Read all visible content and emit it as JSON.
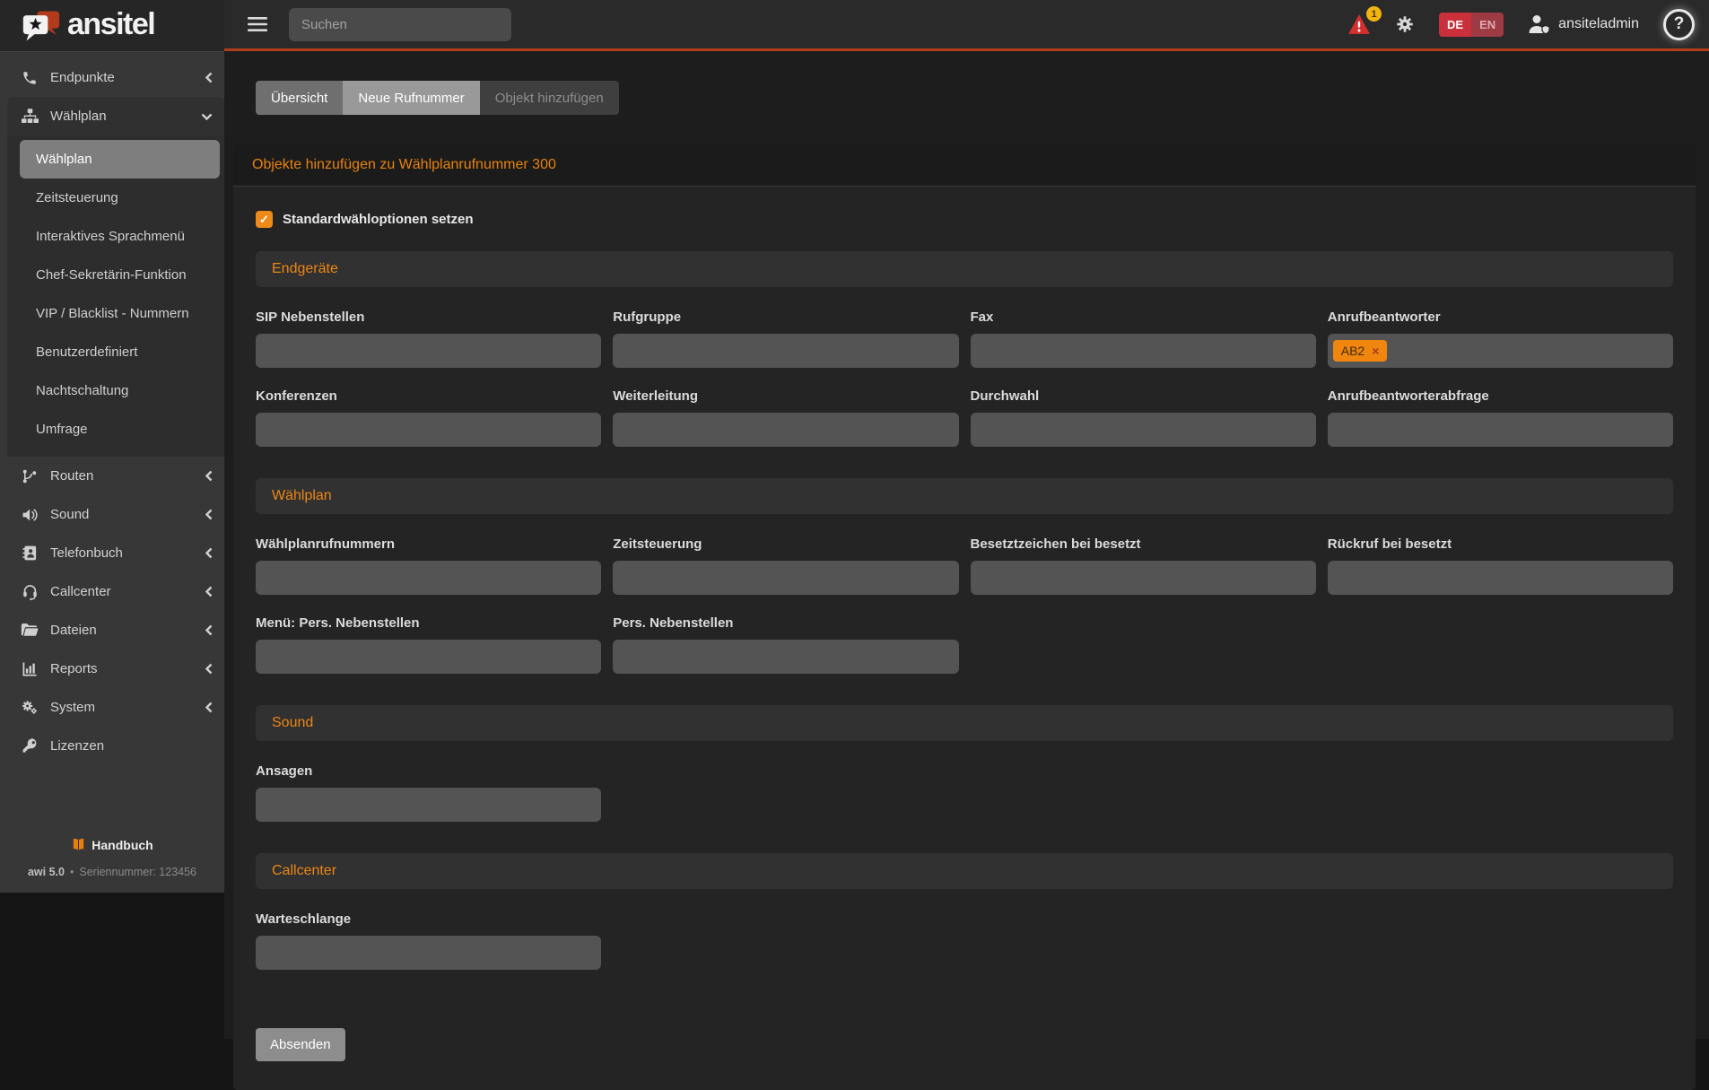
{
  "brand": {
    "name": "ansitel",
    "logo_icon": "speech-bubble-star-icon"
  },
  "topbar": {
    "search_placeholder": "Suchen",
    "alert_badge": "1",
    "languages": {
      "de": "DE",
      "en": "EN"
    },
    "username": "ansiteladmin",
    "help_glyph": "?"
  },
  "sidebar": {
    "items": [
      {
        "label": "Endpunkte",
        "icon": "phone-icon"
      },
      {
        "label": "Wählplan",
        "icon": "sitemap-icon",
        "expanded": true
      },
      {
        "label": "Routen",
        "icon": "route-branch-icon"
      },
      {
        "label": "Sound",
        "icon": "speaker-icon"
      },
      {
        "label": "Telefonbuch",
        "icon": "address-book-icon"
      },
      {
        "label": "Callcenter",
        "icon": "headset-icon"
      },
      {
        "label": "Dateien",
        "icon": "folder-open-icon"
      },
      {
        "label": "Reports",
        "icon": "bar-chart-icon"
      },
      {
        "label": "System",
        "icon": "gears-icon"
      },
      {
        "label": "Lizenzen",
        "icon": "key-icon"
      }
    ],
    "waehlplan_children": [
      "Wählplan",
      "Zeitsteuerung",
      "Interaktives Sprachmenü",
      "Chef-Sekretärin-Funktion",
      "VIP / Blacklist - Nummern",
      "Benutzerdefiniert",
      "Nachtschaltung",
      "Umfrage"
    ],
    "active_child": "Wählplan",
    "footer": {
      "manual": "Handbuch",
      "version": "awi 5.0",
      "dot": "•",
      "serial": "Seriennummer: 123456"
    }
  },
  "tabs": [
    {
      "label": "Übersicht",
      "state": "normal"
    },
    {
      "label": "Neue Rufnummer",
      "state": "highlighted"
    },
    {
      "label": "Objekt hinzufügen",
      "state": "disabled"
    }
  ],
  "form": {
    "title": "Objekte hinzufügen zu Wählplanrufnummer 300",
    "checkbox": {
      "label": "Standardwähloptionen setzen",
      "checked": true,
      "check_glyph": "✓"
    },
    "sections": [
      {
        "title": "Endgeräte",
        "fields": [
          {
            "label": "SIP Nebenstellen",
            "value": ""
          },
          {
            "label": "Rufgruppe",
            "value": ""
          },
          {
            "label": "Fax",
            "value": ""
          },
          {
            "label": "Anrufbeantworter",
            "value": "",
            "tags": [
              "AB2"
            ]
          },
          {
            "label": "Konferenzen",
            "value": ""
          },
          {
            "label": "Weiterleitung",
            "value": ""
          },
          {
            "label": "Durchwahl",
            "value": ""
          },
          {
            "label": "Anrufbeantworterabfrage",
            "value": ""
          }
        ]
      },
      {
        "title": "Wählplan",
        "fields": [
          {
            "label": "Wählplanrufnummern",
            "value": ""
          },
          {
            "label": "Zeitsteuerung",
            "value": ""
          },
          {
            "label": "Besetztzeichen bei besetzt",
            "value": ""
          },
          {
            "label": "Rückruf bei besetzt",
            "value": ""
          },
          {
            "label": "Menü: Pers. Nebenstellen",
            "value": ""
          },
          {
            "label": "Pers. Nebenstellen",
            "value": ""
          }
        ]
      },
      {
        "title": "Sound",
        "fields": [
          {
            "label": "Ansagen",
            "value": ""
          }
        ]
      },
      {
        "title": "Callcenter",
        "fields": [
          {
            "label": "Warteschlange",
            "value": ""
          }
        ]
      }
    ],
    "tag_remove_glyph": "×",
    "submit_label": "Absenden"
  },
  "colors": {
    "accent_orange": "#ee8613",
    "panel_title_orange": "#e8820c",
    "topbar_line": "#b03e1c",
    "lang_de_bg": "#c9303c",
    "lang_en_bg": "#9d3a44",
    "alert_red": "#d32f2f",
    "badge_yellow": "#f2b411",
    "tag_bg": "#f0860d",
    "active_subitem_bg": "#7e7e7e"
  }
}
